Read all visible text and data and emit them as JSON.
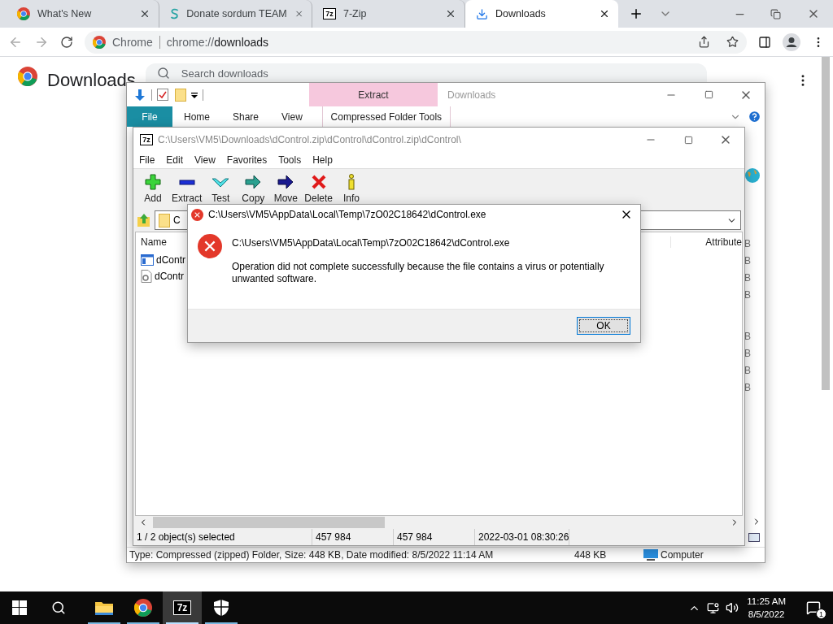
{
  "browser": {
    "tabs": [
      {
        "title": "What's New",
        "kind": "browser",
        "selected": false
      },
      {
        "title": "Donate sordum TEAM",
        "kind": "sordum",
        "selected": false
      },
      {
        "title": "7-Zip",
        "kind": "sevenzip",
        "icon_text": "7z",
        "selected": false
      },
      {
        "title": "Downloads",
        "kind": "download",
        "selected": true
      }
    ],
    "address": {
      "site_label": "Chrome",
      "url_prefix": "chrome://",
      "url_path": "downloads"
    },
    "page": {
      "title": "Downloads",
      "search": {
        "placeholder": "Search downloads"
      }
    }
  },
  "explorer": {
    "contextual_tab": "Extract",
    "title": "Downloads",
    "file_tab": "File",
    "ribbon_tabs": [
      "Home",
      "Share",
      "View"
    ],
    "contextual_group": "Compressed Folder Tools",
    "size_fragments": [
      [
        "B",
        "B",
        "B",
        "B"
      ],
      [
        "B",
        "B",
        "B",
        "B"
      ]
    ],
    "status": {
      "details": "Type: Compressed (zipped) Folder, Size: 448 KB, Date modified: 8/5/2022 11:14 AM",
      "size": "448 KB",
      "location": "Computer"
    }
  },
  "sevenzip": {
    "logo_text": "7z",
    "title": "C:\\Users\\VM5\\Downloads\\dControl.zip\\dControl\\dControl.zip\\dControl\\",
    "menu": [
      "File",
      "Edit",
      "View",
      "Favorites",
      "Tools",
      "Help"
    ],
    "toolbar": [
      {
        "label": "Add",
        "kind": "add"
      },
      {
        "label": "Extract",
        "kind": "extract"
      },
      {
        "label": "Test",
        "kind": "test"
      },
      {
        "label": "Copy",
        "kind": "copy"
      },
      {
        "label": "Move",
        "kind": "move"
      },
      {
        "label": "Delete",
        "kind": "delete"
      },
      {
        "label": "Info",
        "kind": "info"
      }
    ],
    "address": "C",
    "columns": [
      "Name",
      "Attribute"
    ],
    "files": [
      {
        "name": "dContr",
        "kind": "app"
      },
      {
        "name": "dContr",
        "kind": "settings"
      }
    ],
    "status": [
      "1 / 2 object(s) selected",
      "457 984",
      "457 984",
      "2022-03-01 08:30:26"
    ]
  },
  "dialog": {
    "title": "C:\\Users\\VM5\\AppData\\Local\\Temp\\7zO02C18642\\dControl.exe",
    "path": "C:\\Users\\VM5\\AppData\\Local\\Temp\\7zO02C18642\\dControl.exe",
    "message": "Operation did not complete successfully because the file contains a virus or potentially unwanted software.",
    "button": "OK"
  },
  "taskbar": {
    "apps": [
      {
        "kind": "folder",
        "selected": false
      },
      {
        "kind": "browser",
        "selected": false
      },
      {
        "kind": "sevenzip",
        "icon_text": "7z",
        "selected": true
      },
      {
        "kind": "shield",
        "selected": false
      }
    ],
    "time": "11:25 AM",
    "date": "8/5/2022",
    "notifications": "1"
  }
}
